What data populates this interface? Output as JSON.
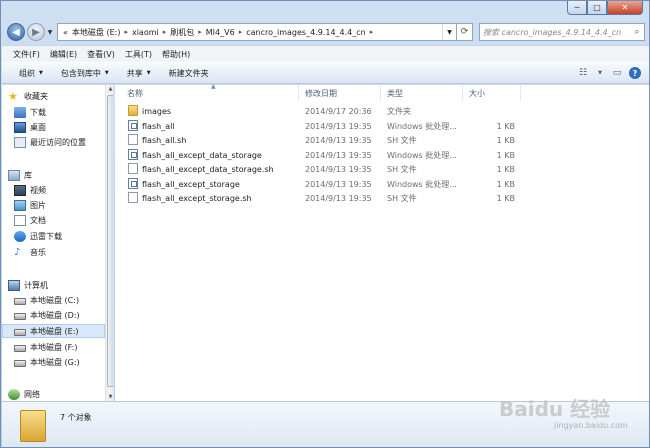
{
  "window": {
    "caption": {
      "minimize": "─",
      "maximize": "□",
      "close": "✕"
    }
  },
  "nav_buttons": {
    "back": "◀",
    "forward": "▶",
    "dropdown": "▼"
  },
  "address": {
    "prefix": "«",
    "crumbs": [
      "本地磁盘 (E:)",
      "xiaomi",
      "刷机包",
      "MI4_V6",
      "cancro_images_4.9.14_4.4_cn"
    ],
    "separator": "▸",
    "dropdown": "▼",
    "refresh": "⟳"
  },
  "search": {
    "placeholder": "搜索 cancro_images_4.9.14_4.4_cn",
    "icon": "⌕"
  },
  "menubar": [
    "文件(F)",
    "编辑(E)",
    "查看(V)",
    "工具(T)",
    "帮助(H)"
  ],
  "cmdbar": {
    "organize": "组织",
    "include": "包含到库中",
    "share": "共享",
    "new_folder": "新建文件夹",
    "arrow": "▼",
    "views_icon": "☷",
    "preview_icon": "▭",
    "help_icon": "?"
  },
  "sidebar": {
    "favorites": {
      "label": "收藏夹",
      "items": [
        "下载",
        "桌面",
        "最近访问的位置"
      ]
    },
    "libraries": {
      "label": "库",
      "items": [
        "视频",
        "图片",
        "文档",
        "迅雷下载",
        "音乐"
      ]
    },
    "computer": {
      "label": "计算机",
      "items": [
        "本地磁盘 (C:)",
        "本地磁盘 (D:)",
        "本地磁盘 (E:)",
        "本地磁盘 (F:)",
        "本地磁盘 (G:)"
      ],
      "selected_index": 2
    },
    "network": {
      "label": "网络"
    },
    "scroll": {
      "up": "▲",
      "down": "▼"
    }
  },
  "columns": {
    "name": "名称",
    "date": "修改日期",
    "type": "类型",
    "size": "大小",
    "sort_arrow": "▲"
  },
  "files": [
    {
      "name": "images",
      "date": "2014/9/17 20:36",
      "type": "文件夹",
      "size": "",
      "kind": "folder"
    },
    {
      "name": "flash_all",
      "date": "2014/9/13 19:35",
      "type": "Windows 批处理...",
      "size": "1 KB",
      "kind": "bat"
    },
    {
      "name": "flash_all.sh",
      "date": "2014/9/13 19:35",
      "type": "SH 文件",
      "size": "1 KB",
      "kind": "sh"
    },
    {
      "name": "flash_all_except_data_storage",
      "date": "2014/9/13 19:35",
      "type": "Windows 批处理...",
      "size": "1 KB",
      "kind": "bat"
    },
    {
      "name": "flash_all_except_data_storage.sh",
      "date": "2014/9/13 19:35",
      "type": "SH 文件",
      "size": "1 KB",
      "kind": "sh"
    },
    {
      "name": "flash_all_except_storage",
      "date": "2014/9/13 19:35",
      "type": "Windows 批处理...",
      "size": "1 KB",
      "kind": "bat"
    },
    {
      "name": "flash_all_except_storage.sh",
      "date": "2014/9/13 19:35",
      "type": "SH 文件",
      "size": "1 KB",
      "kind": "sh"
    }
  ],
  "details": {
    "count": "7 个对象"
  },
  "watermark": {
    "text": "Baidu 经验",
    "sub": "jingyan.baidu.com"
  }
}
